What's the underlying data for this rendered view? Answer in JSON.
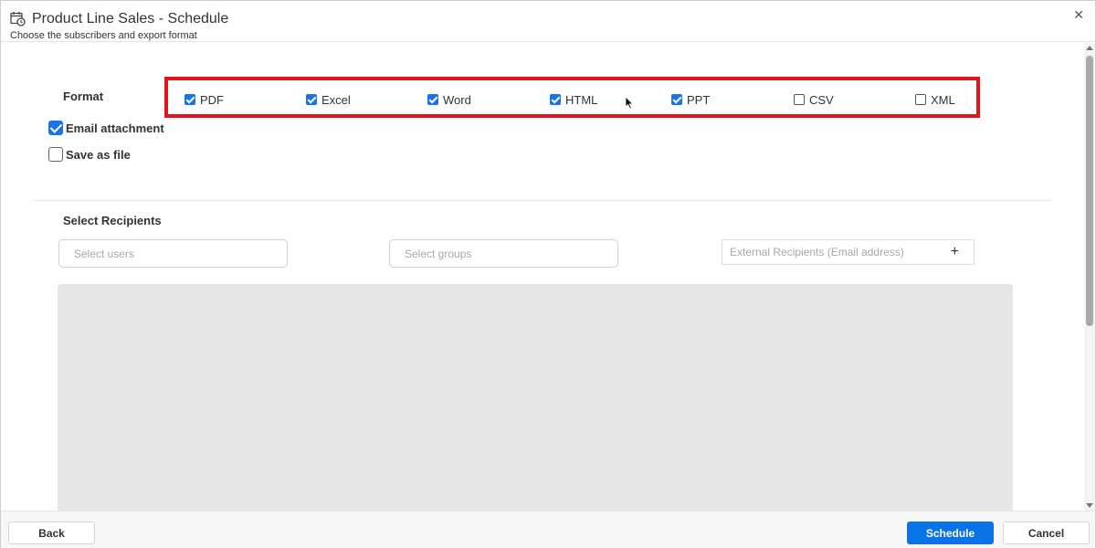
{
  "header": {
    "title": "Product Line Sales - Schedule",
    "subtitle": "Choose the subscribers and export format",
    "close_glyph": "✕"
  },
  "format": {
    "label": "Format",
    "options": [
      {
        "label": "PDF",
        "checked": true
      },
      {
        "label": "Excel",
        "checked": true
      },
      {
        "label": "Word",
        "checked": true
      },
      {
        "label": "HTML",
        "checked": true
      },
      {
        "label": "PPT",
        "checked": true
      },
      {
        "label": "CSV",
        "checked": false
      },
      {
        "label": "XML",
        "checked": false
      }
    ],
    "highlight_color": "#e3151a"
  },
  "delivery": {
    "email_attachment": {
      "label": "Email attachment",
      "checked": true
    },
    "save_as_file": {
      "label": "Save as file",
      "checked": false
    }
  },
  "recipients": {
    "label": "Select Recipients",
    "users_placeholder": "Select users",
    "groups_placeholder": "Select groups",
    "external_placeholder": "External Recipients (Email address)",
    "add_glyph": "+"
  },
  "footer": {
    "back_label": "Back",
    "schedule_label": "Schedule",
    "cancel_label": "Cancel"
  },
  "colors": {
    "accent": "#0a73e8",
    "panel": "#e6e6e6"
  }
}
